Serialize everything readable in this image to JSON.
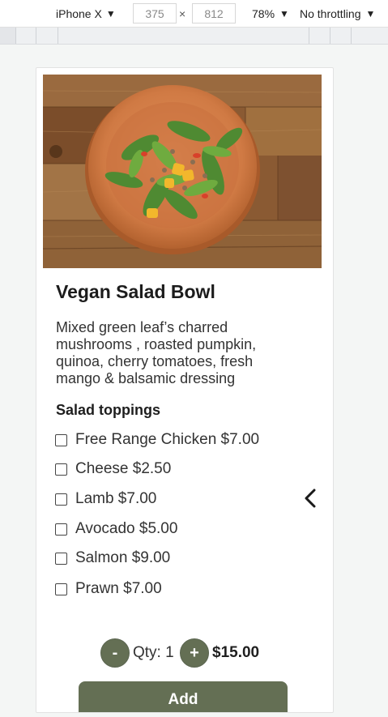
{
  "devtools": {
    "device": "iPhone X",
    "width": "375",
    "times": "×",
    "height": "812",
    "zoom": "78%",
    "throttling": "No throttling",
    "dropdown_icon": "triangle-down-icon"
  },
  "product": {
    "title": "Vegan Salad Bowl",
    "description": "Mixed green leaf’s charred mushrooms , roasted pumpkin, quinoa, cherry tomatoes, fresh mango & balsamic dressing",
    "toppings_title": "Salad toppings",
    "toppings": [
      {
        "label": "Free Range Chicken $7.00",
        "checked": false
      },
      {
        "label": "Cheese $2.50",
        "checked": false
      },
      {
        "label": "Lamb $7.00",
        "checked": false
      },
      {
        "label": "Avocado $5.00",
        "checked": false
      },
      {
        "label": "Salmon $9.00",
        "checked": false
      },
      {
        "label": "Prawn $7.00",
        "checked": false
      }
    ],
    "qty_minus": "-",
    "qty_text": "Qty: 1",
    "qty_plus": "+",
    "total": "$15.00",
    "add_label": "Add"
  },
  "colors": {
    "accent": "#646f54",
    "page_bg": "#f4f6f5"
  },
  "icons": {
    "carousel_prev": "chevron-left-icon"
  }
}
